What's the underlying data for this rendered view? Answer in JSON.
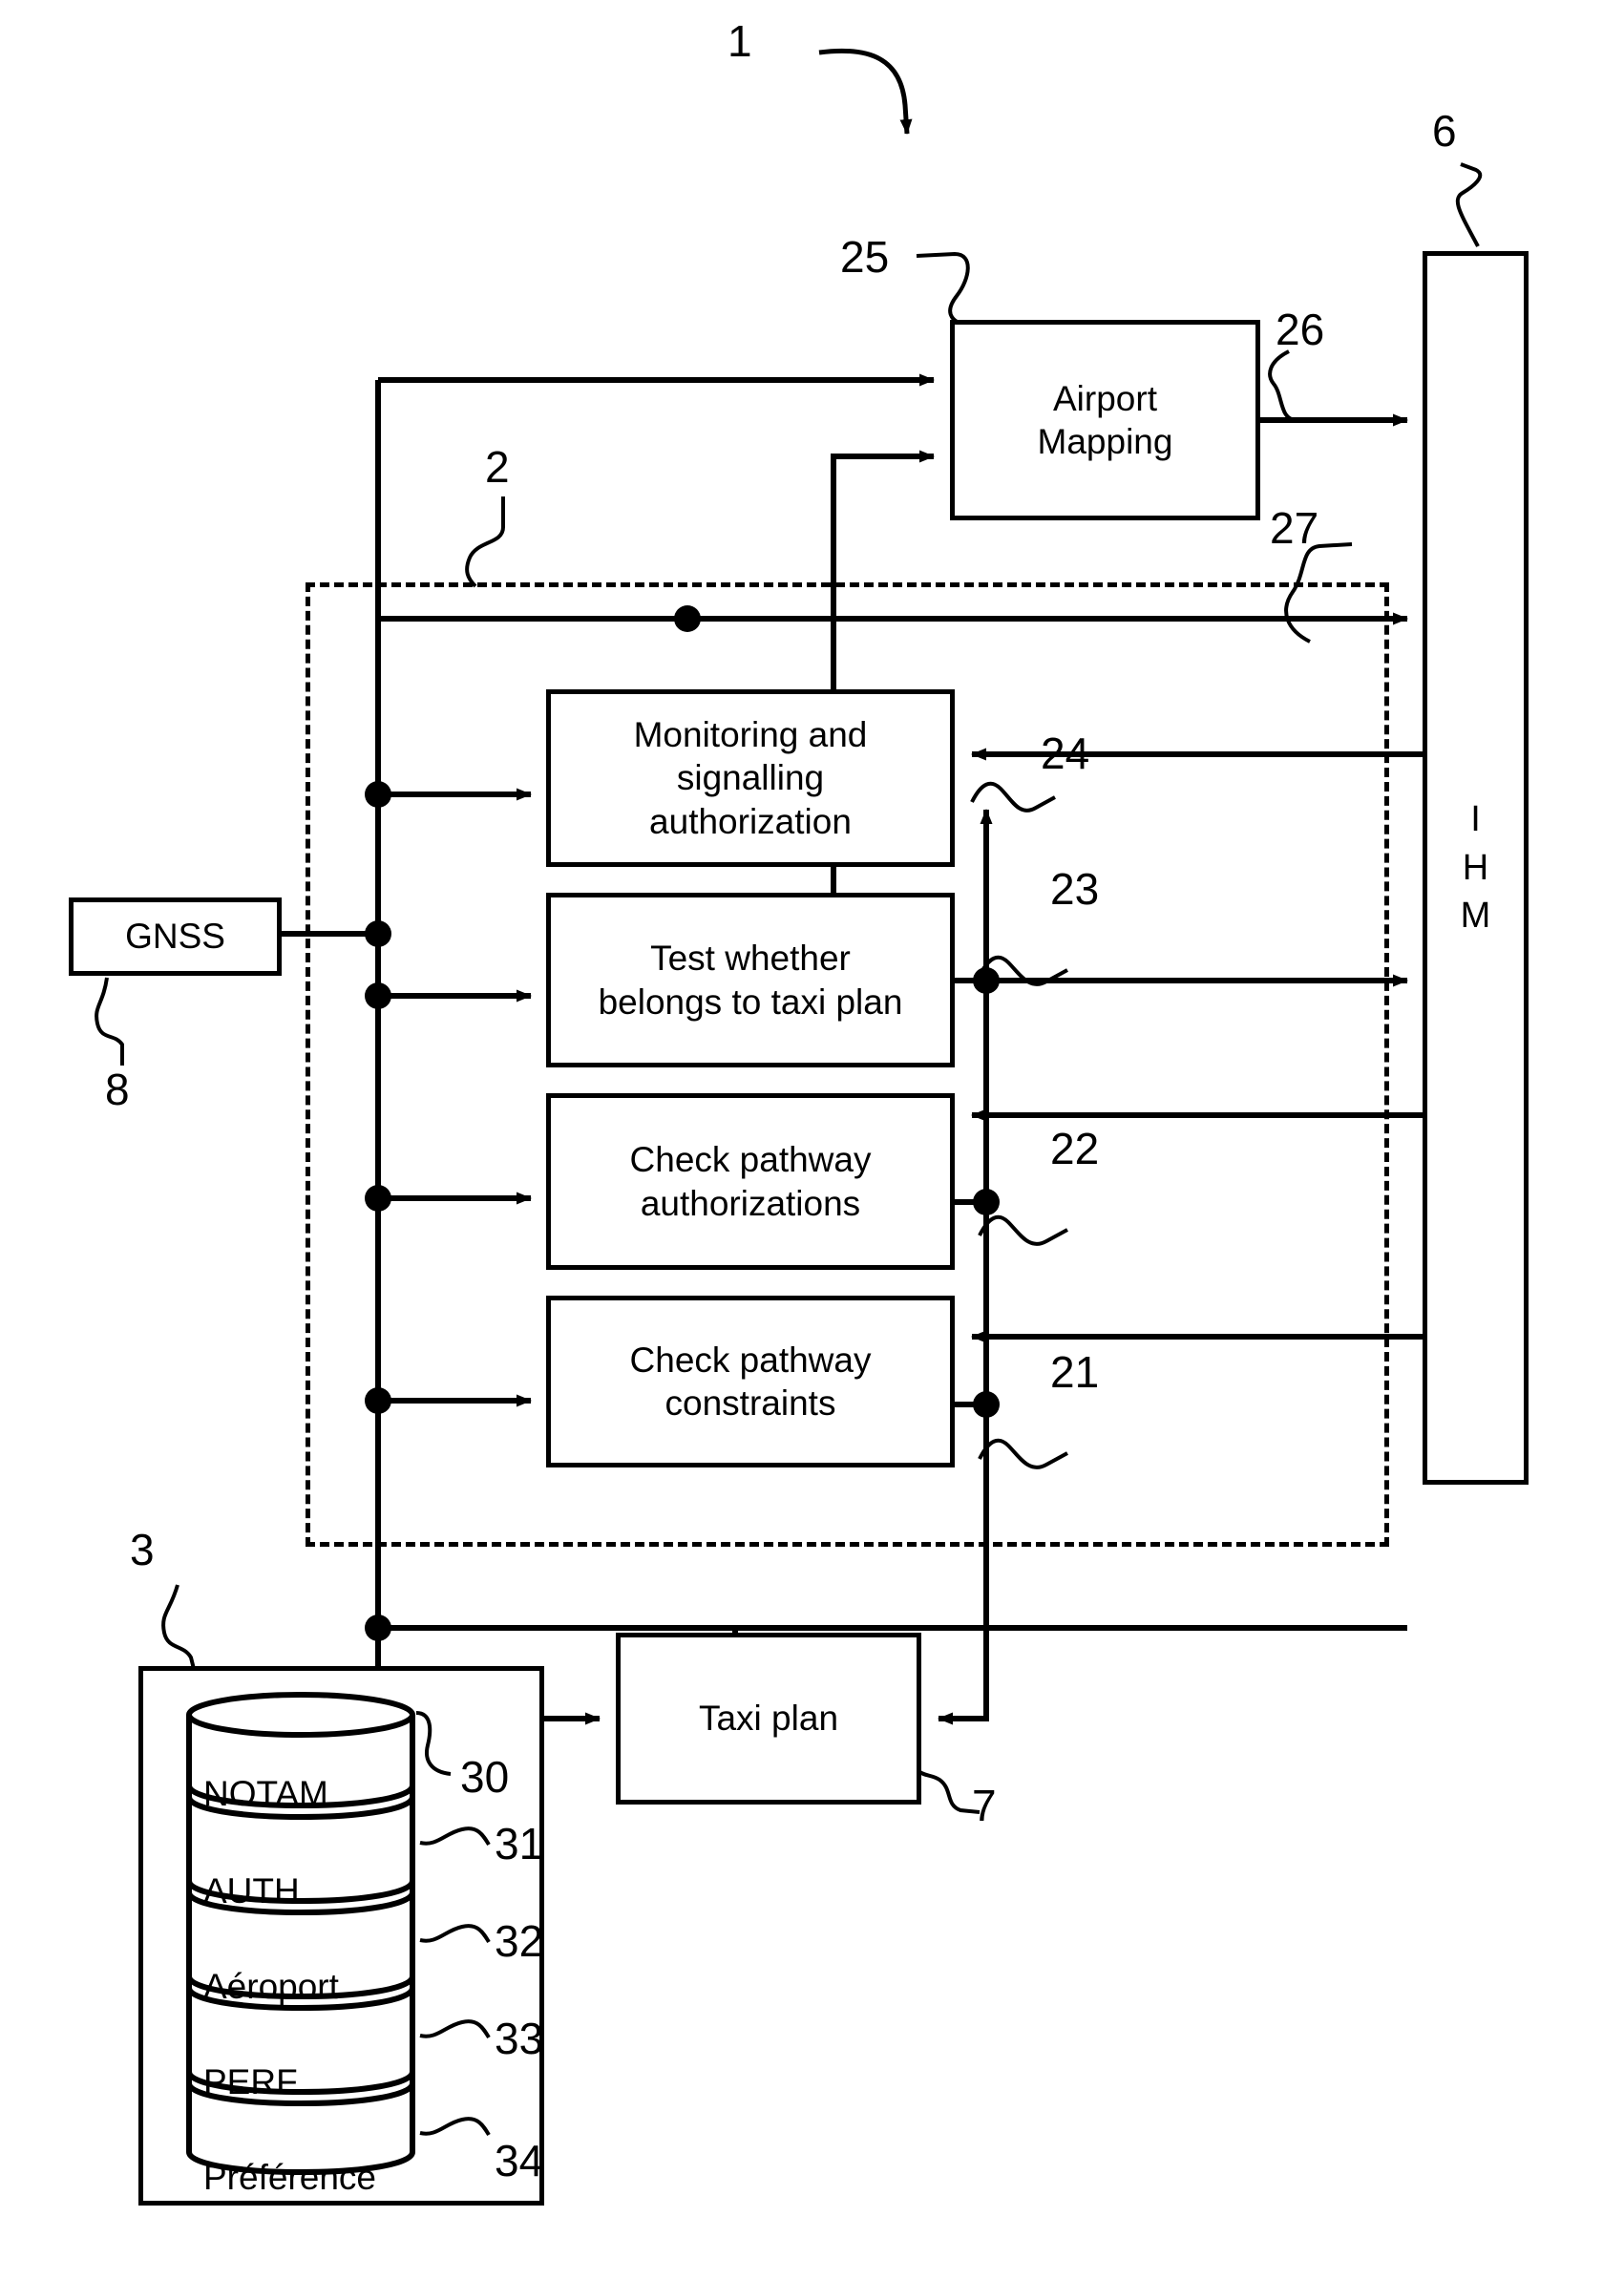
{
  "figure": {
    "number": "1",
    "type": "patent-block-diagram",
    "language_note": "mixed English / French labels"
  },
  "blocks": {
    "airport_mapping": {
      "label": "Airport\nMapping",
      "ref": "25",
      "out_ref": "26"
    },
    "monitoring": {
      "label": "Monitoring and\nsignalling\nauthorization",
      "ref": "24"
    },
    "test_taxi_plan": {
      "label": "Test whether\nbelongs to taxi plan",
      "ref": "23"
    },
    "check_auth": {
      "label": "Check pathway\nauthorizations",
      "ref": "22"
    },
    "check_constraints": {
      "label": "Check pathway\nconstraints",
      "ref": "21"
    },
    "gnss": {
      "label": "GNSS",
      "ref": "8"
    },
    "taxi_plan": {
      "label": "Taxi plan",
      "ref": "7"
    },
    "ihm": {
      "label": "I\nH\nM",
      "ref": "6"
    },
    "dashed_module": {
      "ref": "2",
      "out_ref": "27"
    },
    "database_enclosure": {
      "ref": "3"
    }
  },
  "airport_mapping_lines": [
    "Airport",
    "Mapping"
  ],
  "monitoring_lines": [
    "Monitoring and",
    "signalling",
    "authorization"
  ],
  "test_taxi_plan_lines": [
    "Test whether",
    "belongs to taxi plan"
  ],
  "check_auth_lines": [
    "Check pathway",
    "authorizations"
  ],
  "check_constraints_lines": [
    "Check pathway",
    "constraints"
  ],
  "ihm_lines": [
    "I",
    "H",
    "M"
  ],
  "database": {
    "sections": [
      {
        "label": "NOTAM",
        "ref": "30"
      },
      {
        "label": "AUTH",
        "ref": "31"
      },
      {
        "label": "Aéroport",
        "ref": "32"
      },
      {
        "label": "PERF",
        "ref": "33"
      },
      {
        "label": "Préférence",
        "ref": "34"
      }
    ]
  },
  "reference_numerals": {
    "figure": "1",
    "dashed_module": "2",
    "database_enclosure": "3",
    "ihm": "6",
    "taxi_plan": "7",
    "gnss": "8",
    "check_constraints": "21",
    "check_auth": "22",
    "test_taxi_plan": "23",
    "monitoring": "24",
    "airport_mapping": "25",
    "airport_mapping_output": "26",
    "module_output": "27",
    "db_notam": "30",
    "db_auth": "31",
    "db_aeroport": "32",
    "db_perf": "33",
    "db_preference": "34"
  },
  "colors": {
    "ink": "#000000",
    "paper": "#ffffff"
  }
}
